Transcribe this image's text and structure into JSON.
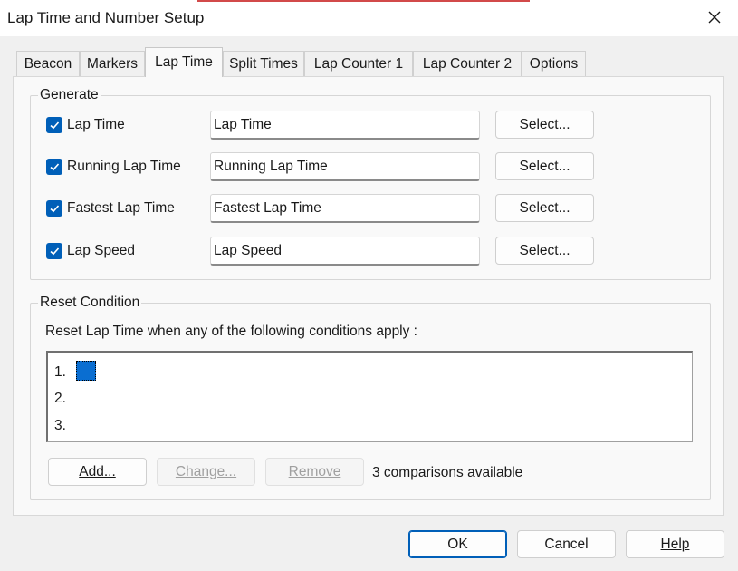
{
  "window": {
    "title": "Lap Time and Number Setup",
    "accent_color": "#d24a4a"
  },
  "tabs": [
    {
      "label": "Beacon"
    },
    {
      "label": "Markers"
    },
    {
      "label": "Lap Time",
      "active": true
    },
    {
      "label": "Split Times"
    },
    {
      "label": "Lap Counter 1"
    },
    {
      "label": "Lap Counter 2"
    },
    {
      "label": "Options"
    }
  ],
  "generate": {
    "legend": "Generate",
    "rows": [
      {
        "label": "Lap Time",
        "checked": true,
        "value": "Lap Time",
        "button": "Select..."
      },
      {
        "label": "Running Lap Time",
        "checked": true,
        "value": "Running Lap Time",
        "button": "Select..."
      },
      {
        "label": "Fastest Lap Time",
        "checked": true,
        "value": "Fastest Lap Time",
        "button": "Select..."
      },
      {
        "label": "Lap Speed",
        "checked": true,
        "value": "Lap Speed",
        "button": "Select..."
      }
    ]
  },
  "reset": {
    "legend": "Reset Condition",
    "description": "Reset Lap Time when any of the following conditions apply :",
    "items": [
      "1.",
      "2.",
      "3."
    ],
    "add_label": "Add...",
    "change_label": "Change...",
    "remove_label": "Remove",
    "available_text": "3 comparisons available"
  },
  "footer": {
    "ok_label": "OK",
    "cancel_label": "Cancel",
    "help_label": "Help"
  },
  "colors": {
    "checkbox": "#005fb8",
    "selection": "#0a6ed1"
  }
}
